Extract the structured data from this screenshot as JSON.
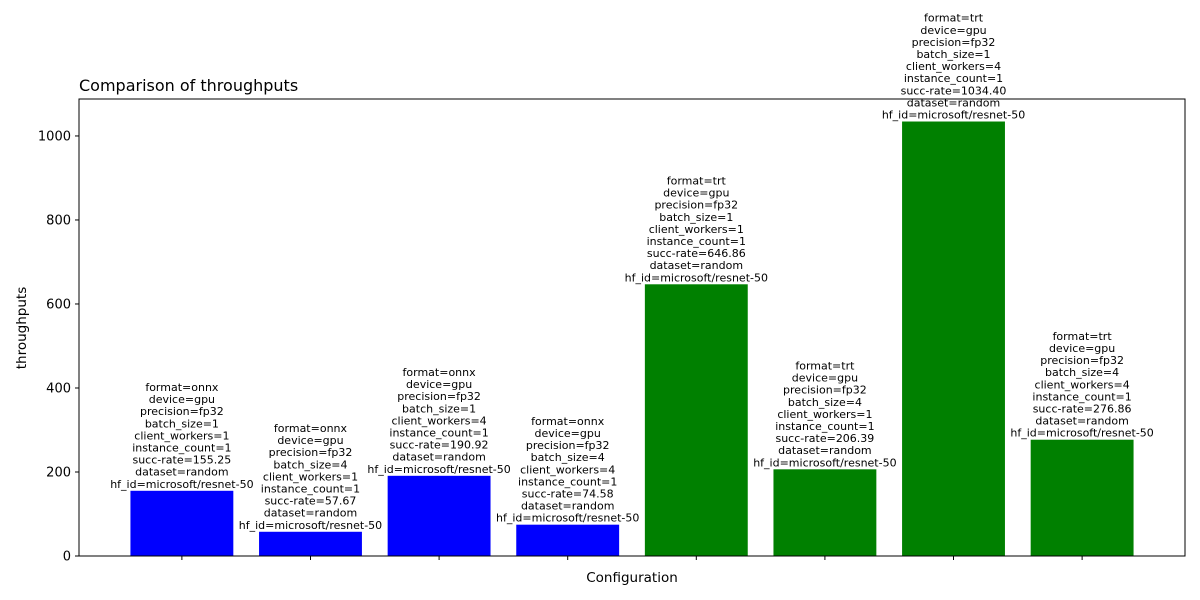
{
  "chart_data": {
    "type": "bar",
    "title": "Comparison of throughputs",
    "xlabel": "Configuration",
    "ylabel": "throughputs",
    "ylim": [
      0,
      1088
    ],
    "yticks": [
      0,
      200,
      400,
      600,
      800,
      1000
    ],
    "grid": false,
    "legend": "none",
    "colors": {
      "onnx": "#0000ff",
      "trt": "#008000"
    },
    "categories": [
      "",
      "",
      "",
      "",
      "",
      "",
      "",
      ""
    ],
    "values": [
      155.25,
      57.67,
      190.92,
      74.58,
      646.86,
      206.39,
      1034.4,
      276.86
    ],
    "bars": [
      {
        "format": "onnx",
        "color": "#0000ff",
        "value": 155.25,
        "annotation": [
          "format=onnx",
          "device=gpu",
          "precision=fp32",
          "batch_size=1",
          "client_workers=1",
          "instance_count=1",
          "succ-rate=155.25",
          "dataset=random",
          "hf_id=microsoft/resnet-50"
        ]
      },
      {
        "format": "onnx",
        "color": "#0000ff",
        "value": 57.67,
        "annotation": [
          "format=onnx",
          "device=gpu",
          "precision=fp32",
          "batch_size=4",
          "client_workers=1",
          "instance_count=1",
          "succ-rate=57.67",
          "dataset=random",
          "hf_id=microsoft/resnet-50"
        ]
      },
      {
        "format": "onnx",
        "color": "#0000ff",
        "value": 190.92,
        "annotation": [
          "format=onnx",
          "device=gpu",
          "precision=fp32",
          "batch_size=1",
          "client_workers=4",
          "instance_count=1",
          "succ-rate=190.92",
          "dataset=random",
          "hf_id=microsoft/resnet-50"
        ]
      },
      {
        "format": "onnx",
        "color": "#0000ff",
        "value": 74.58,
        "annotation": [
          "format=onnx",
          "device=gpu",
          "precision=fp32",
          "batch_size=4",
          "client_workers=4",
          "instance_count=1",
          "succ-rate=74.58",
          "dataset=random",
          "hf_id=microsoft/resnet-50"
        ]
      },
      {
        "format": "trt",
        "color": "#008000",
        "value": 646.86,
        "annotation": [
          "format=trt",
          "device=gpu",
          "precision=fp32",
          "batch_size=1",
          "client_workers=1",
          "instance_count=1",
          "succ-rate=646.86",
          "dataset=random",
          "hf_id=microsoft/resnet-50"
        ]
      },
      {
        "format": "trt",
        "color": "#008000",
        "value": 206.39,
        "annotation": [
          "format=trt",
          "device=gpu",
          "precision=fp32",
          "batch_size=4",
          "client_workers=1",
          "instance_count=1",
          "succ-rate=206.39",
          "dataset=random",
          "hf_id=microsoft/resnet-50"
        ]
      },
      {
        "format": "trt",
        "color": "#008000",
        "value": 1034.4,
        "annotation": [
          "format=trt",
          "device=gpu",
          "precision=fp32",
          "batch_size=1",
          "client_workers=4",
          "instance_count=1",
          "succ-rate=1034.40",
          "dataset=random",
          "hf_id=microsoft/resnet-50"
        ]
      },
      {
        "format": "trt",
        "color": "#008000",
        "value": 276.86,
        "annotation": [
          "format=trt",
          "device=gpu",
          "precision=fp32",
          "batch_size=4",
          "client_workers=4",
          "instance_count=1",
          "succ-rate=276.86",
          "dataset=random",
          "hf_id=microsoft/resnet-50"
        ]
      }
    ]
  }
}
